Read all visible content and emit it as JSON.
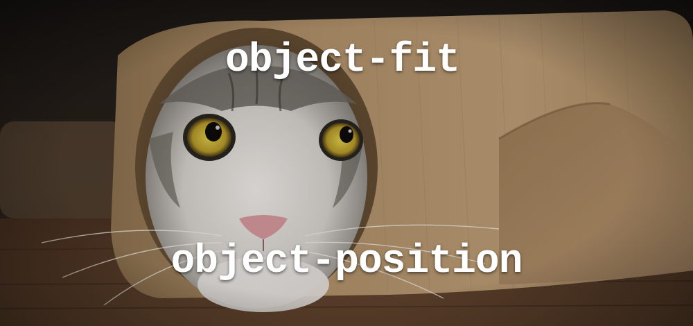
{
  "image": {
    "subject": "cat-in-paper-roll",
    "colors": {
      "paper": "#b9986a",
      "floor": "#5a3e2a",
      "background": "#2a211b",
      "eyes": "#c9b43a",
      "nose": "#d99aa0",
      "fur_white": "#e9e6e2",
      "fur_grey": "#6b6660"
    }
  },
  "captions": {
    "top": "object-fit",
    "bottom": "object-position"
  }
}
